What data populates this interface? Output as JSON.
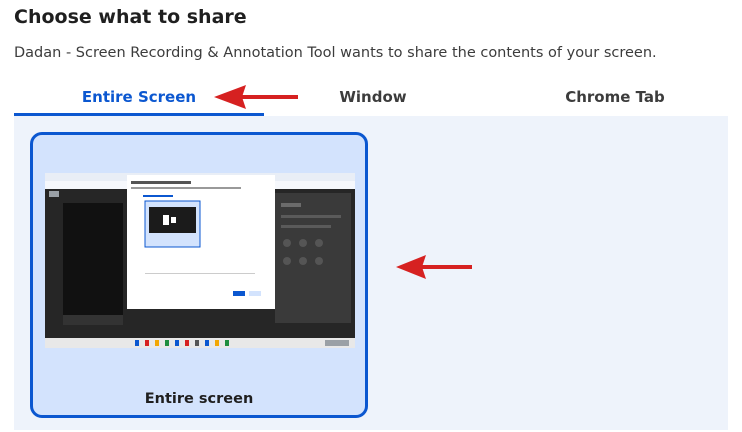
{
  "dialog": {
    "title": "Choose what to share",
    "subtitle": "Dadan - Screen Recording & Annotation Tool wants to share the contents of your screen."
  },
  "tabs": [
    {
      "label": "Entire Screen",
      "active": true
    },
    {
      "label": "Window",
      "active": false
    },
    {
      "label": "Chrome Tab",
      "active": false
    }
  ],
  "sources": [
    {
      "label": "Entire screen",
      "selected": true
    }
  ],
  "colors": {
    "accent": "#0b57d0",
    "annotation_arrow": "#d62121",
    "selected_tile_bg": "#d3e3fd",
    "content_bg": "#eef3fb"
  },
  "icons": {
    "arrow_to_tab": "red-arrow-left-icon",
    "arrow_to_tile": "red-arrow-left-icon"
  }
}
